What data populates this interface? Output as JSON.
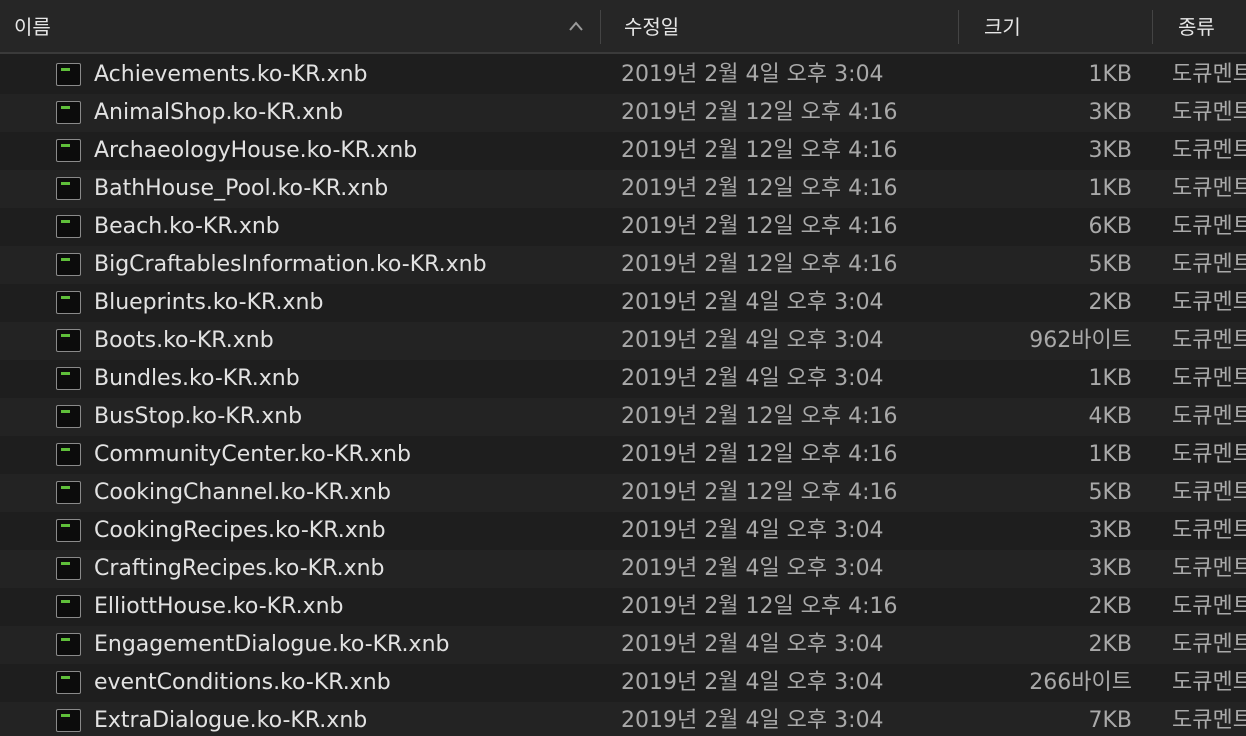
{
  "columns": {
    "name": "이름",
    "modified": "수정일",
    "size": "크기",
    "kind": "종류"
  },
  "sort_icon": "chevron-up-icon",
  "file_icon": "document-icon",
  "colors": {
    "background": "#1e1e1e",
    "header": "#262626",
    "stripe": "#232323",
    "text": "#e2e2e2",
    "muted_text": "#a9a9a9",
    "icon_accent": "#5fbf3a"
  },
  "files": [
    {
      "name": "Achievements.ko-KR.xnb",
      "modified": "2019년 2월 4일 오후 3:04",
      "size": "1KB",
      "kind": "도큐멘트"
    },
    {
      "name": "AnimalShop.ko-KR.xnb",
      "modified": "2019년 2월 12일 오후 4:16",
      "size": "3KB",
      "kind": "도큐멘트"
    },
    {
      "name": "ArchaeologyHouse.ko-KR.xnb",
      "modified": "2019년 2월 12일 오후 4:16",
      "size": "3KB",
      "kind": "도큐멘트"
    },
    {
      "name": "BathHouse_Pool.ko-KR.xnb",
      "modified": "2019년 2월 12일 오후 4:16",
      "size": "1KB",
      "kind": "도큐멘트"
    },
    {
      "name": "Beach.ko-KR.xnb",
      "modified": "2019년 2월 12일 오후 4:16",
      "size": "6KB",
      "kind": "도큐멘트"
    },
    {
      "name": "BigCraftablesInformation.ko-KR.xnb",
      "modified": "2019년 2월 12일 오후 4:16",
      "size": "5KB",
      "kind": "도큐멘트"
    },
    {
      "name": "Blueprints.ko-KR.xnb",
      "modified": "2019년 2월 4일 오후 3:04",
      "size": "2KB",
      "kind": "도큐멘트"
    },
    {
      "name": "Boots.ko-KR.xnb",
      "modified": "2019년 2월 4일 오후 3:04",
      "size": "962바이트",
      "kind": "도큐멘트"
    },
    {
      "name": "Bundles.ko-KR.xnb",
      "modified": "2019년 2월 4일 오후 3:04",
      "size": "1KB",
      "kind": "도큐멘트"
    },
    {
      "name": "BusStop.ko-KR.xnb",
      "modified": "2019년 2월 12일 오후 4:16",
      "size": "4KB",
      "kind": "도큐멘트"
    },
    {
      "name": "CommunityCenter.ko-KR.xnb",
      "modified": "2019년 2월 12일 오후 4:16",
      "size": "1KB",
      "kind": "도큐멘트"
    },
    {
      "name": "CookingChannel.ko-KR.xnb",
      "modified": "2019년 2월 12일 오후 4:16",
      "size": "5KB",
      "kind": "도큐멘트"
    },
    {
      "name": "CookingRecipes.ko-KR.xnb",
      "modified": "2019년 2월 4일 오후 3:04",
      "size": "3KB",
      "kind": "도큐멘트"
    },
    {
      "name": "CraftingRecipes.ko-KR.xnb",
      "modified": "2019년 2월 4일 오후 3:04",
      "size": "3KB",
      "kind": "도큐멘트"
    },
    {
      "name": "ElliottHouse.ko-KR.xnb",
      "modified": "2019년 2월 12일 오후 4:16",
      "size": "2KB",
      "kind": "도큐멘트"
    },
    {
      "name": "EngagementDialogue.ko-KR.xnb",
      "modified": "2019년 2월 4일 오후 3:04",
      "size": "2KB",
      "kind": "도큐멘트"
    },
    {
      "name": "eventConditions.ko-KR.xnb",
      "modified": "2019년 2월 4일 오후 3:04",
      "size": "266바이트",
      "kind": "도큐멘트"
    },
    {
      "name": "ExtraDialogue.ko-KR.xnb",
      "modified": "2019년 2월 4일 오후 3:04",
      "size": "7KB",
      "kind": "도큐멘트"
    }
  ]
}
